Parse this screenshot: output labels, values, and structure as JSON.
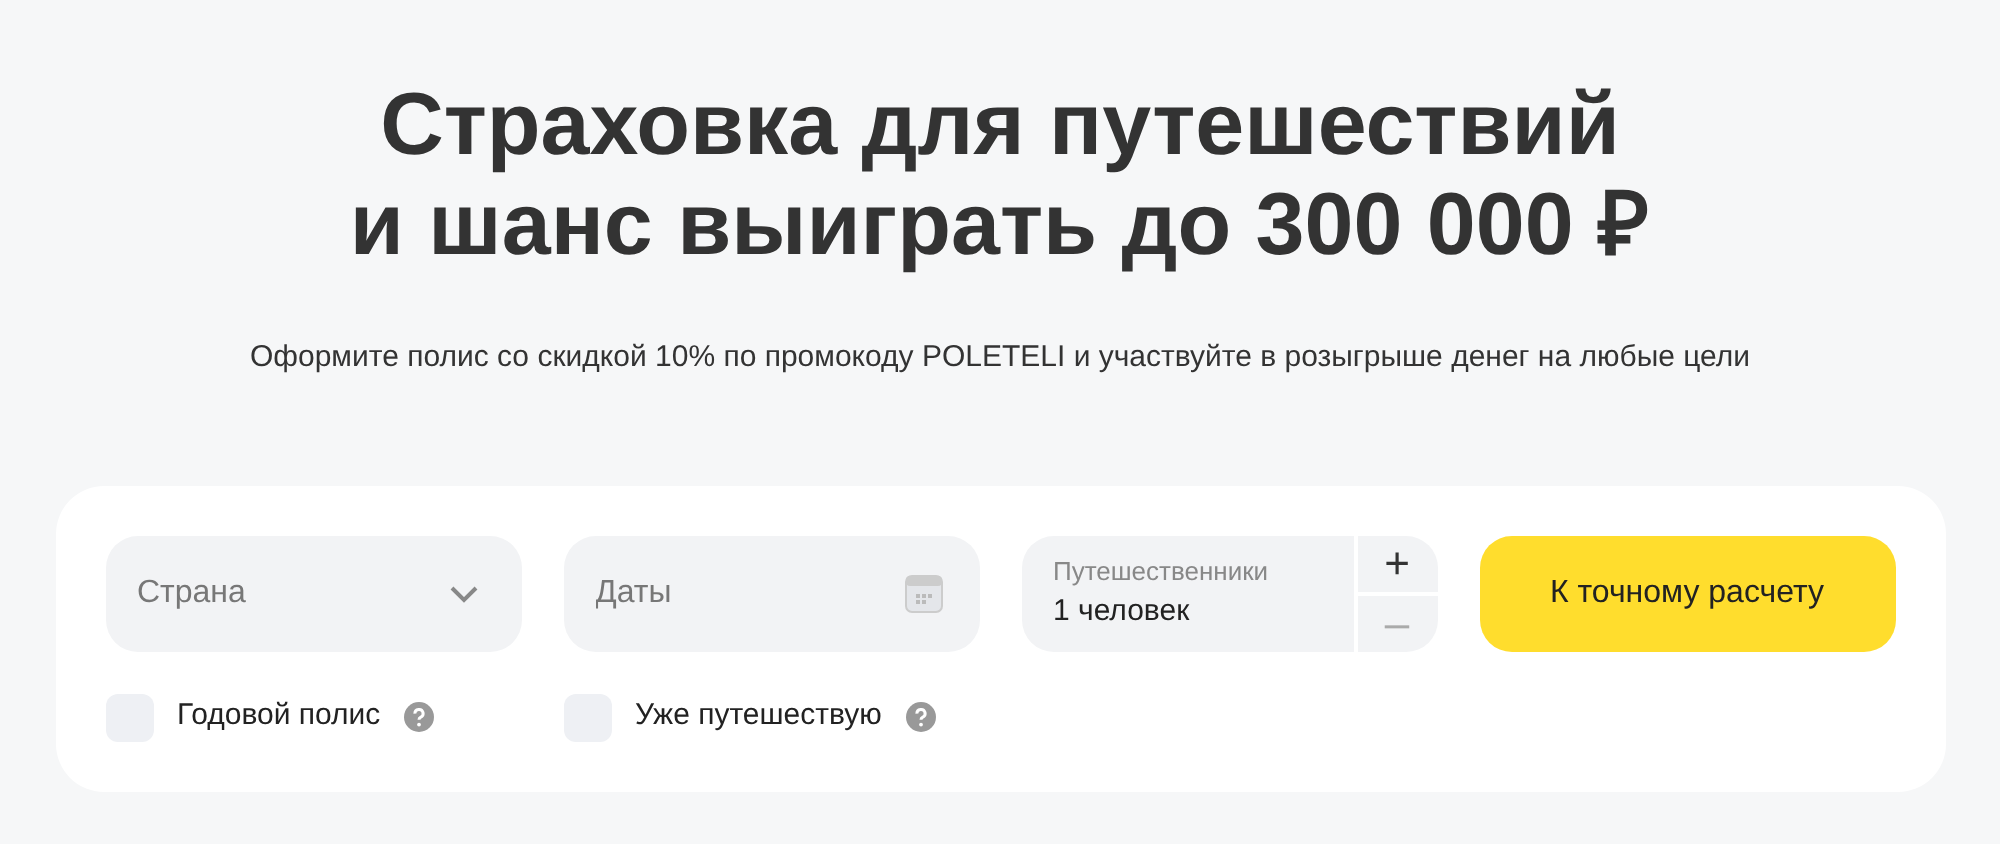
{
  "title": [
    "Страховка для путешествий",
    "и шанс выиграть до 300 000 ₽"
  ],
  "subtitle": "Оформите полис со скидкой 10% по промокоду POLETELI и участвуйте в розыгрыше денег на любые цели",
  "form": {
    "country": {
      "placeholder": "Страна"
    },
    "dates": {
      "placeholder": "Даты"
    },
    "travelers": {
      "label": "Путешественники",
      "value": "1 человек",
      "stepper": [
        {
          "label": "+",
          "disabled": false
        },
        {
          "label": "–",
          "disabled": true
        }
      ]
    },
    "submit": "К точному расчету",
    "options": [
      {
        "label": "Годовой полис",
        "checked": false
      },
      {
        "label": "Уже путешествую",
        "checked": false
      }
    ]
  }
}
